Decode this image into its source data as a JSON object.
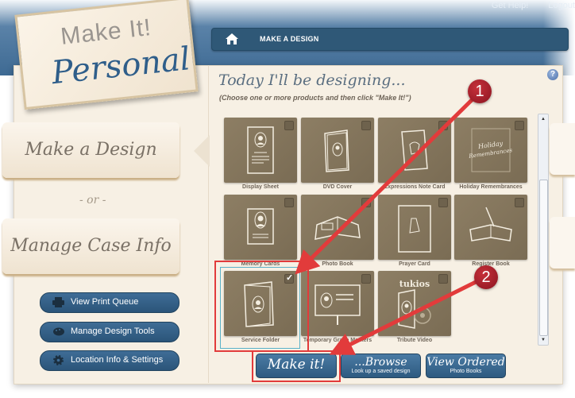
{
  "header": {
    "links": [
      "Get Help!",
      "Logout"
    ],
    "breadcrumb": "MAKE A DESIGN",
    "home_icon": "home-icon"
  },
  "logo": {
    "line1": "Make It!",
    "line2": "Personal"
  },
  "sidebar": {
    "make_design": "Make a Design",
    "or": "- or -",
    "manage_case": "Manage Case Info",
    "buttons": [
      {
        "label": "View Print Queue",
        "icon": "printer-icon"
      },
      {
        "label": "Manage Design Tools",
        "icon": "palette-icon"
      },
      {
        "label": "Location Info & Settings",
        "icon": "gear-icon"
      }
    ]
  },
  "main": {
    "title": "Today I'll be designing...",
    "subtitle": "(Choose one or more products and then click \"Make It!\")",
    "help": "?",
    "products": [
      {
        "label": "Display Sheet",
        "checked": false
      },
      {
        "label": "DVD Cover",
        "checked": false
      },
      {
        "label": "Expressions Note Card",
        "checked": false
      },
      {
        "label": "Holiday Remembrances",
        "checked": false,
        "tile_text": "Holiday Remembrances"
      },
      {
        "label": "Memory Cards",
        "checked": false
      },
      {
        "label": "Photo Book",
        "checked": false
      },
      {
        "label": "Prayer Card",
        "checked": false
      },
      {
        "label": "Register Book",
        "checked": false
      },
      {
        "label": "Service Folder",
        "checked": true
      },
      {
        "label": "Temporary Grave Markers",
        "checked": false
      },
      {
        "label": "Tribute Video",
        "checked": false,
        "tile_text": "tukios"
      }
    ],
    "actions": {
      "make_it": "Make it!",
      "browse": "...Browse",
      "browse_sub": "Look up a saved design",
      "view_ordered": "View Ordered",
      "view_ordered_sub": "Photo Books"
    }
  },
  "annotations": {
    "badge1": "1",
    "badge2": "2",
    "color": "#e23b3b"
  }
}
